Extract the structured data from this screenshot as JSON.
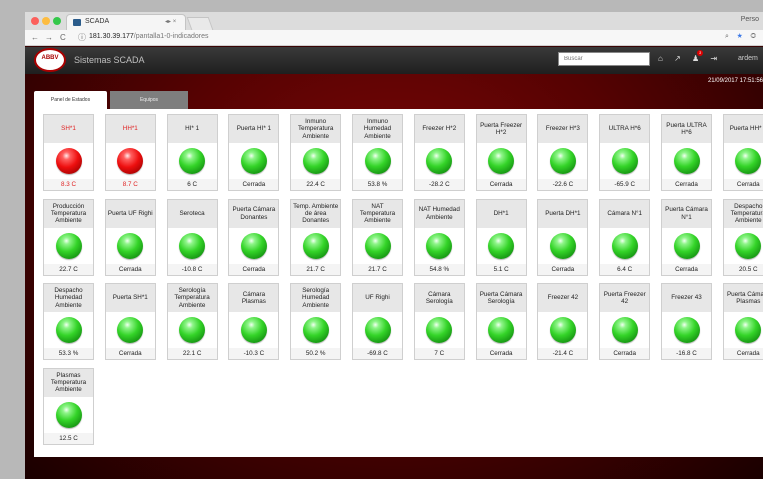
{
  "browser": {
    "tab_title": "SCADA",
    "tab_controls": "◂▸ ×",
    "profile": "Perso",
    "url_host": "181.30.39.177",
    "url_path": "/pantalla1-0-indicadores"
  },
  "header": {
    "logo_text": "ABBV",
    "app_name": "Sistemas SCADA",
    "search_placeholder": "Buscar",
    "alerts_count": "3",
    "user": "ardem",
    "datetime": "21/09/2017 17:51:56"
  },
  "tabs": [
    {
      "label": "Panel de Estados"
    },
    {
      "label": "Equipos"
    }
  ],
  "colors": {
    "alarm": "#e02020",
    "ok": "#34d428",
    "background": "#560202"
  },
  "rows": [
    [
      {
        "title": "SH*1",
        "value": "8.3 C",
        "status": "alarm"
      },
      {
        "title": "HH*1",
        "value": "8.7 C",
        "status": "alarm"
      },
      {
        "title": "HI* 1",
        "value": "6 C",
        "status": "ok"
      },
      {
        "title": "Puerta HI* 1",
        "value": "Cerrada",
        "status": "ok"
      },
      {
        "title": "Inmuno Temperatura Ambiente",
        "value": "22.4 C",
        "status": "ok"
      },
      {
        "title": "Inmuno Humedad Ambiente",
        "value": "53.8 %",
        "status": "ok"
      },
      {
        "title": "Freezer H*2",
        "value": "-28.2 C",
        "status": "ok"
      },
      {
        "title": "Puerta Freezer H*2",
        "value": "Cerrada",
        "status": "ok"
      },
      {
        "title": "Freezer H*3",
        "value": "-22.6 C",
        "status": "ok"
      },
      {
        "title": "ULTRA H*6",
        "value": "-65.9 C",
        "status": "ok"
      },
      {
        "title": "Puerta ULTRA H*6",
        "value": "Cerrada",
        "status": "ok"
      },
      {
        "title": "Puerta HH* 1",
        "value": "Cerrada",
        "status": "ok"
      }
    ],
    [
      {
        "title": "Producción Temperatura Ambiente",
        "value": "22.7 C",
        "status": "ok"
      },
      {
        "title": "Puerta UF Righi",
        "value": "Cerrada",
        "status": "ok"
      },
      {
        "title": "Seroteca",
        "value": "-10.8 C",
        "status": "ok"
      },
      {
        "title": "Puerta Cámara Donantes",
        "value": "Cerrada",
        "status": "ok"
      },
      {
        "title": "Temp. Ambiente de área Donantes",
        "value": "21.7 C",
        "status": "ok"
      },
      {
        "title": "NAT Temperatura Ambiente",
        "value": "21.7 C",
        "status": "ok"
      },
      {
        "title": "NAT Humedad Ambiente",
        "value": "54.8 %",
        "status": "ok"
      },
      {
        "title": "DH*1",
        "value": "5.1 C",
        "status": "ok"
      },
      {
        "title": "Puerta DH*1",
        "value": "Cerrada",
        "status": "ok"
      },
      {
        "title": "Cámara N°1",
        "value": "6.4 C",
        "status": "ok"
      },
      {
        "title": "Puerta Cámara N°1",
        "value": "Cerrada",
        "status": "ok"
      },
      {
        "title": "Despacho Temperatura Ambiente",
        "value": "20.5 C",
        "status": "ok"
      }
    ],
    [
      {
        "title": "Despacho Humedad Ambiente",
        "value": "53.3 %",
        "status": "ok"
      },
      {
        "title": "Puerta SH*1",
        "value": "Cerrada",
        "status": "ok"
      },
      {
        "title": "Serología Temperatura Ambiente",
        "value": "22.1 C",
        "status": "ok"
      },
      {
        "title": "Cámara Plasmas",
        "value": "-10.3 C",
        "status": "ok"
      },
      {
        "title": "Serología Humedad Ambiente",
        "value": "50.2 %",
        "status": "ok"
      },
      {
        "title": "UF Righi",
        "value": "-69.8 C",
        "status": "ok"
      },
      {
        "title": "Cámara Serología",
        "value": "7 C",
        "status": "ok"
      },
      {
        "title": "Puerta Cámara Serología",
        "value": "Cerrada",
        "status": "ok"
      },
      {
        "title": "Freezer 42",
        "value": "-21.4 C",
        "status": "ok"
      },
      {
        "title": "Puerta Freezer 42",
        "value": "Cerrada",
        "status": "ok"
      },
      {
        "title": "Freezer 43",
        "value": "-16.8 C",
        "status": "ok"
      },
      {
        "title": "Puerta Cámara Plasmas",
        "value": "Cerrada",
        "status": "ok"
      }
    ],
    [
      {
        "title": "Plasmas Temperatura Ambiente",
        "value": "12.5 C",
        "status": "ok"
      }
    ]
  ]
}
